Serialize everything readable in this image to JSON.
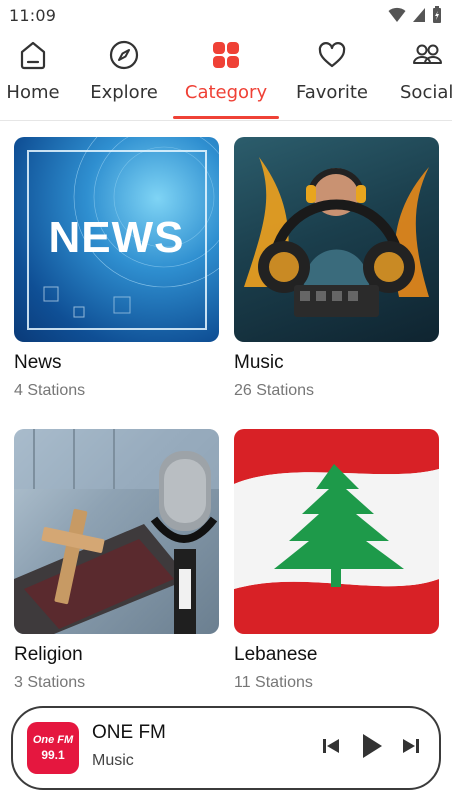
{
  "status_bar": {
    "time": "11:09"
  },
  "nav": {
    "items": [
      {
        "label": "Home",
        "icon": "home-icon"
      },
      {
        "label": "Explore",
        "icon": "compass-icon"
      },
      {
        "label": "Category",
        "icon": "category-grid-icon",
        "active": true
      },
      {
        "label": "Favorite",
        "icon": "heart-icon"
      },
      {
        "label": "Social",
        "icon": "users-icon"
      }
    ]
  },
  "categories": [
    {
      "name": "News",
      "count": "4 Stations",
      "banner_text": "NEWS"
    },
    {
      "name": "Music",
      "count": "26 Stations"
    },
    {
      "name": "Religion",
      "count": "3 Stations"
    },
    {
      "name": "Lebanese",
      "count": "11 Stations"
    }
  ],
  "player": {
    "title": "ONE FM",
    "subtitle": "Music",
    "logo_text": "One FM",
    "logo_freq": "99.1"
  },
  "colors": {
    "accent": "#ef4136",
    "text": "#111111",
    "muted": "#777777",
    "logo_bg": "#e5173f"
  }
}
